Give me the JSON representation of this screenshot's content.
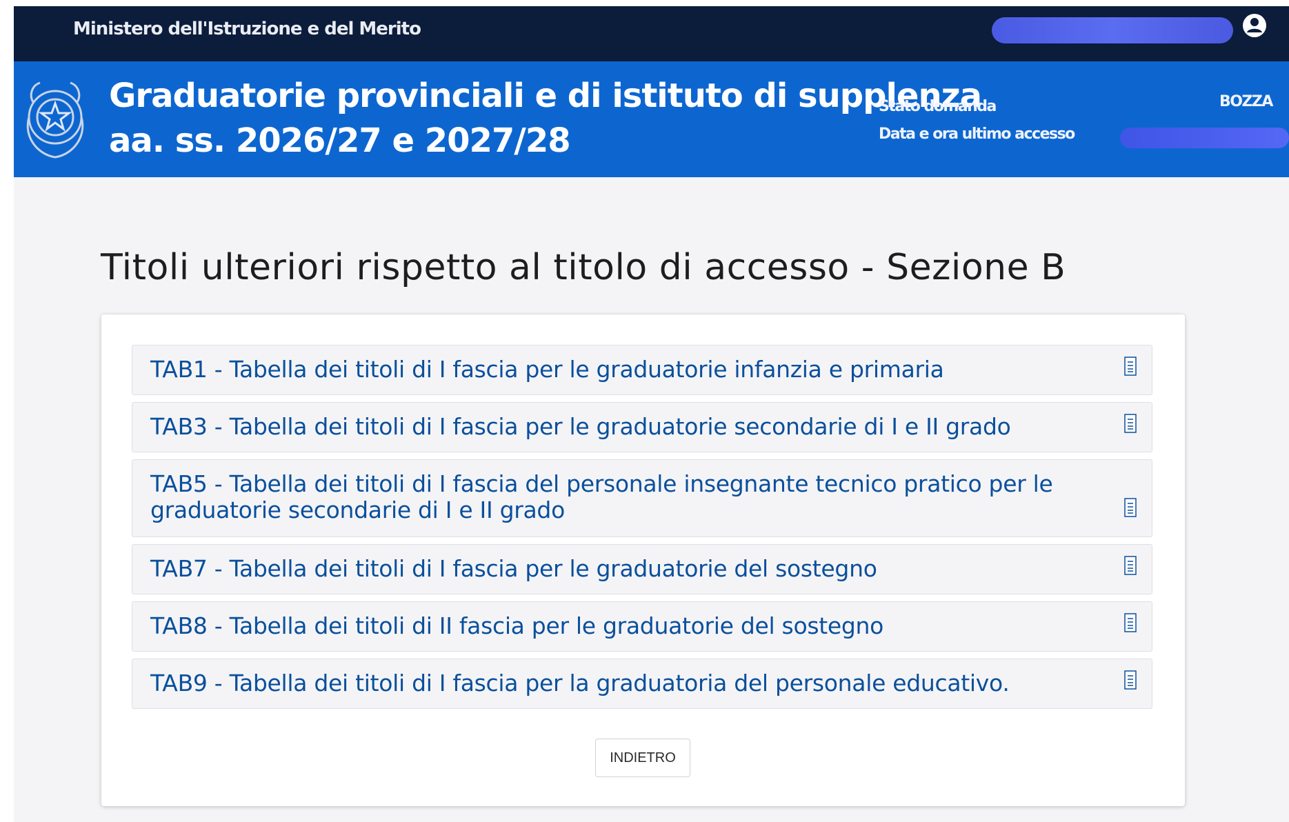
{
  "topbar": {
    "ministry": "Ministero dell'Istruzione e del Merito"
  },
  "header": {
    "title_line1": "Graduatorie provinciali e di istituto di supplenza",
    "title_line2": "aa. ss. 2026/27 e 2027/28",
    "status_label": "Stato domanda",
    "status_value": "BOZZA",
    "last_access_label": "Data e ora ultimo accesso"
  },
  "page": {
    "title": "Titoli ulteriori rispetto al titolo di accesso - Sezione B",
    "items": [
      {
        "label": "TAB1 - Tabella dei titoli di I fascia per le graduatorie infanzia e primaria"
      },
      {
        "label": "TAB3 - Tabella dei titoli di I fascia per le graduatorie secondarie di I e II grado"
      },
      {
        "label": "TAB5 - Tabella dei titoli di I fascia del personale insegnante tecnico pratico per le graduatorie secondarie di I e II grado"
      },
      {
        "label": "TAB7 - Tabella dei titoli di I fascia per le graduatorie del sostegno"
      },
      {
        "label": "TAB8 - Tabella dei titoli di II fascia per le graduatorie del sostegno"
      },
      {
        "label": "TAB9 - Tabella dei titoli di I fascia per la graduatoria del personale educativo."
      }
    ],
    "back_label": "INDIETRO"
  },
  "icons": {
    "user": "user-circle-icon",
    "emblem": "repubblica-emblem-icon",
    "document": "document-icon"
  },
  "colors": {
    "topbar": "#0c1c3b",
    "header": "#0d66d0",
    "link": "#0a4f9c",
    "background": "#f4f3f5"
  }
}
